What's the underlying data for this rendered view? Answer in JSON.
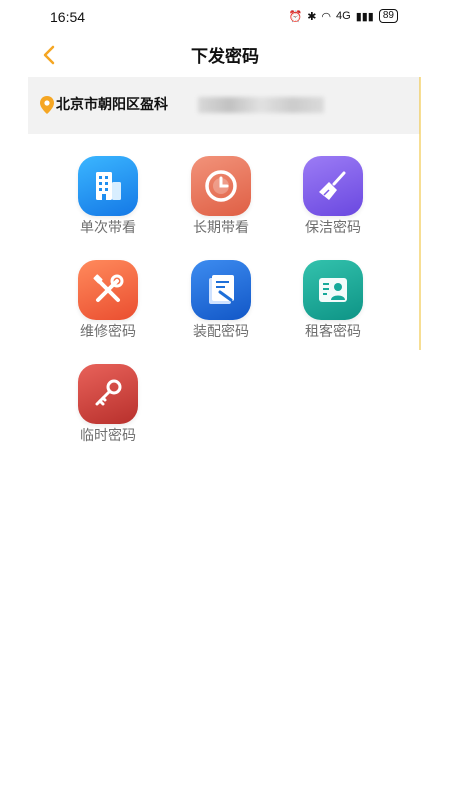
{
  "status": {
    "time": "16:54",
    "network": "4G",
    "battery": "89"
  },
  "header": {
    "title": "下发密码"
  },
  "address": {
    "text": "北京市朝阳区盈科"
  },
  "accent": "#F5A623",
  "menu": [
    {
      "label": "单次带看",
      "icon": "building-icon",
      "color": "#1E9BEF"
    },
    {
      "label": "长期带看",
      "icon": "clock-icon",
      "color": "#E7725A"
    },
    {
      "label": "保洁密码",
      "icon": "broom-icon",
      "color": "#7C5CE8"
    },
    {
      "label": "维修密码",
      "icon": "tools-icon",
      "color": "#F2603E"
    },
    {
      "label": "装配密码",
      "icon": "document-icon",
      "color": "#1E6FD8"
    },
    {
      "label": "租客密码",
      "icon": "tenant-card-icon",
      "color": "#16A99A"
    },
    {
      "label": "临时密码",
      "icon": "key-icon",
      "color": "#D8453E"
    }
  ]
}
